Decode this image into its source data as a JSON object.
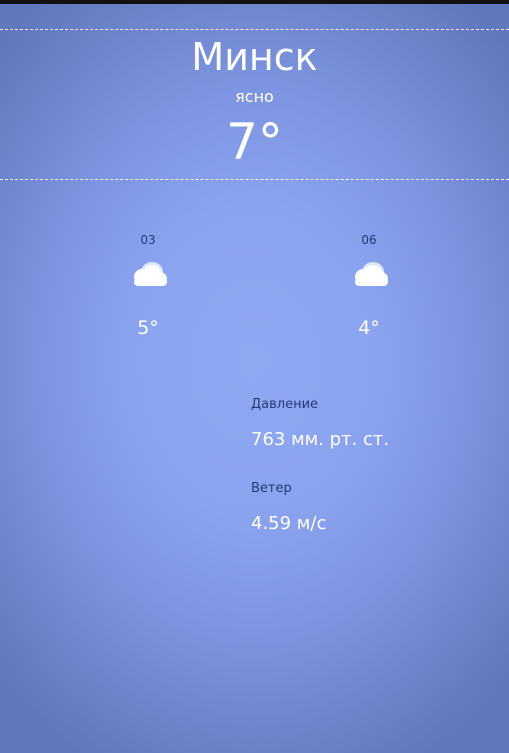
{
  "current": {
    "city": "Минск",
    "condition": "ясно",
    "temperature": "7°"
  },
  "forecast": [
    {
      "hour": "03",
      "icon": "cloudy-icon",
      "temperature": "5°"
    },
    {
      "hour": "06",
      "icon": "cloudy-icon",
      "temperature": "4°"
    }
  ],
  "details": {
    "pressure_label": "Давление",
    "pressure_value": "763 мм. рт. ст.",
    "wind_label": "Ветер",
    "wind_value": "4.59 м/с"
  },
  "colors": {
    "background_center": "#8fa8f2",
    "background_edge": "#6178bd",
    "label_text": "#223a7a",
    "primary_text": "#ffffff"
  }
}
